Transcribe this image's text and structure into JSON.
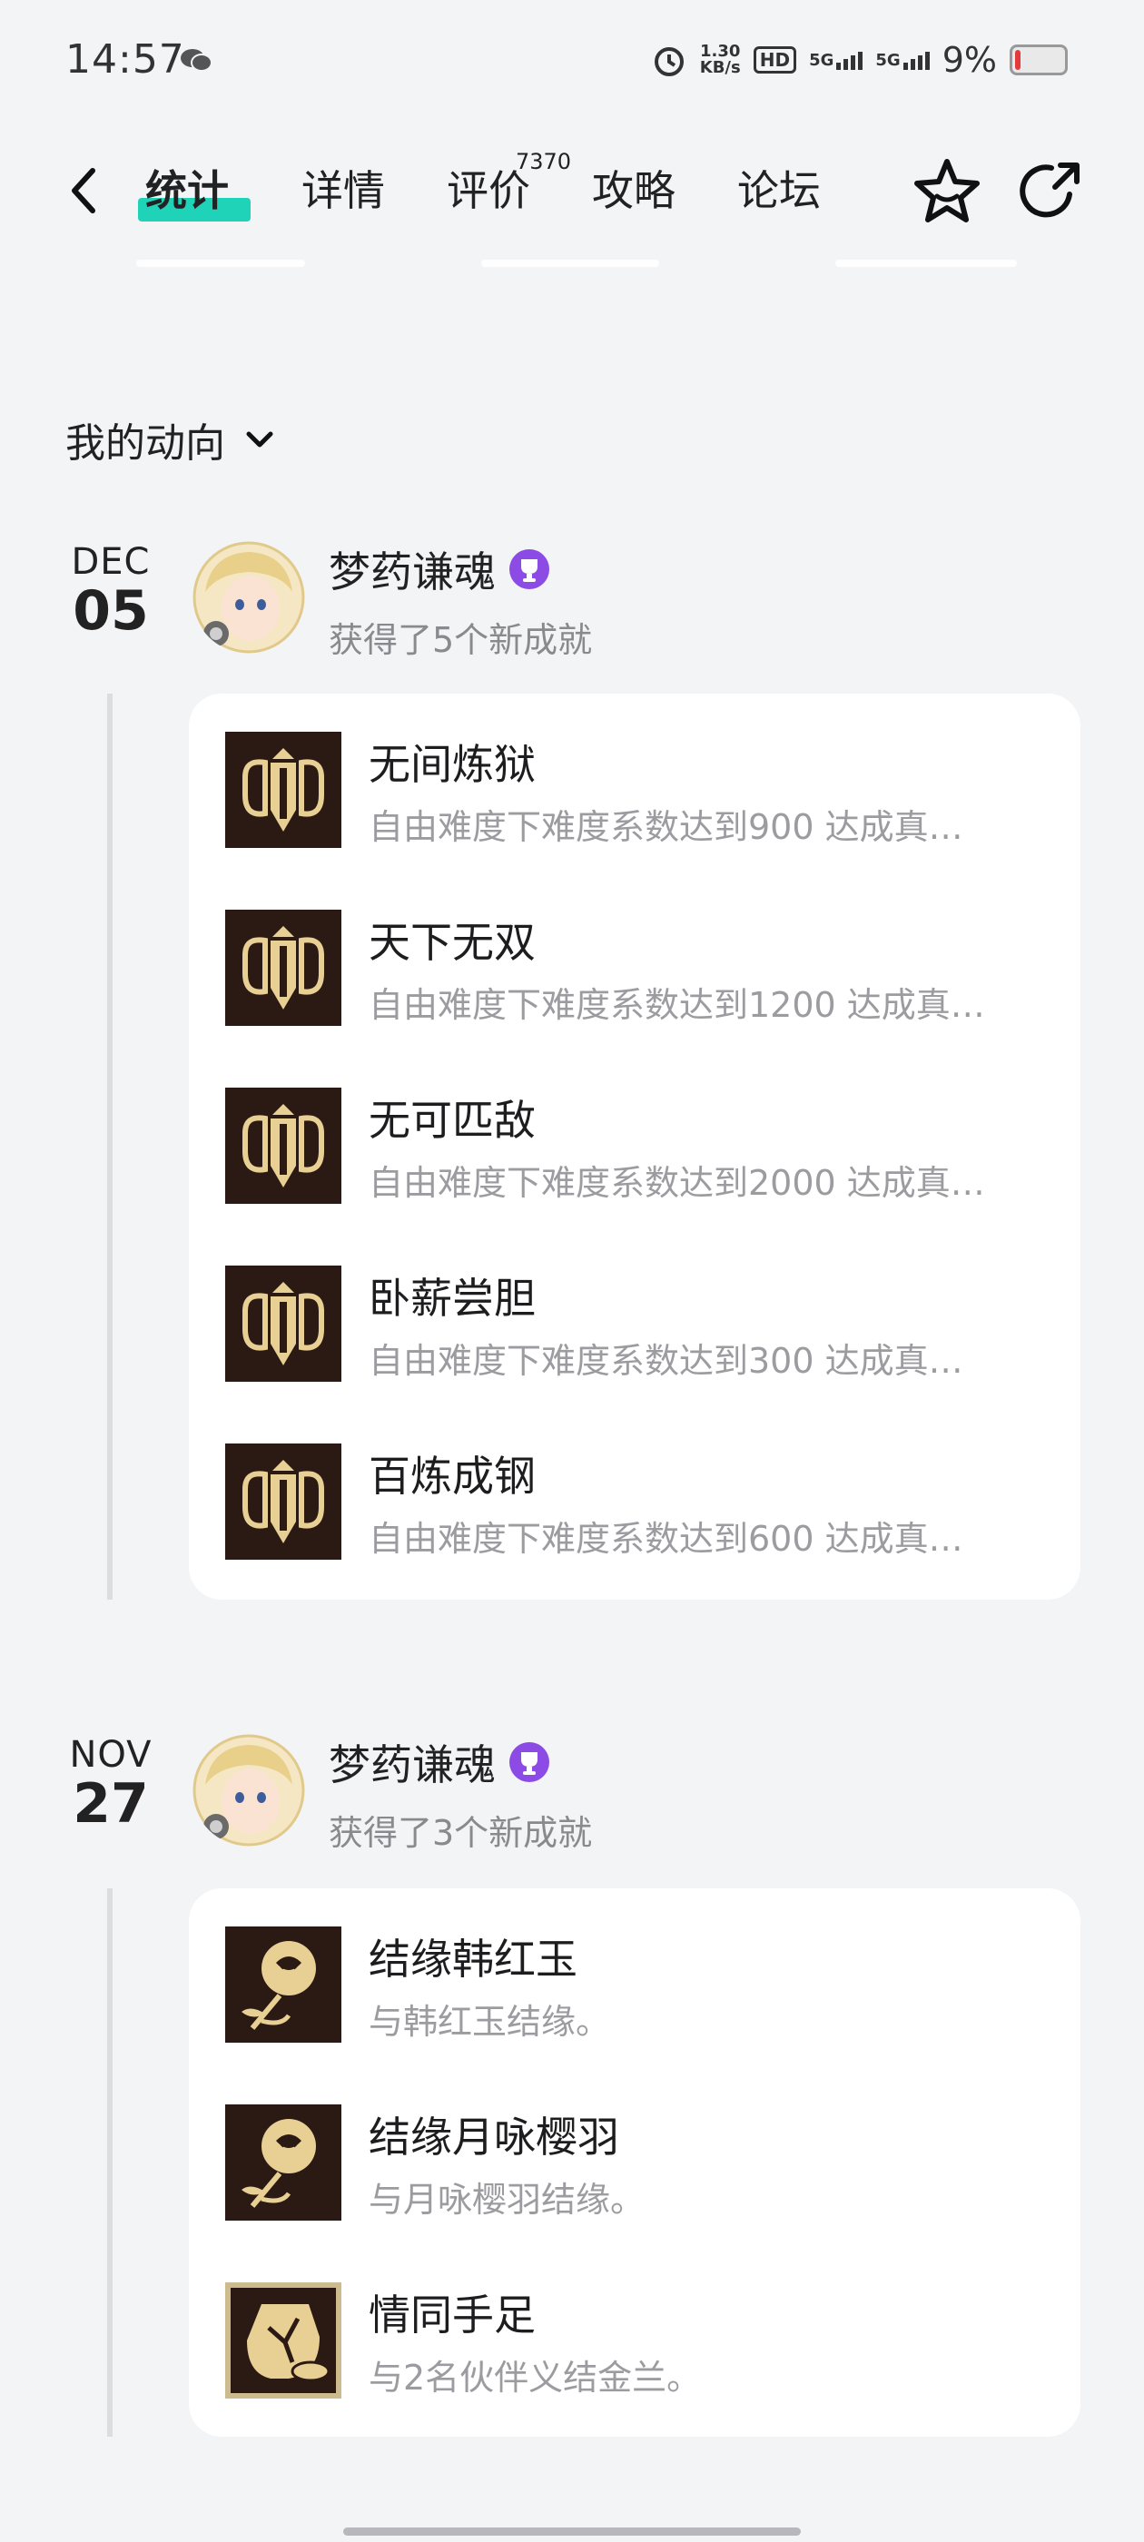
{
  "status_bar": {
    "time": "14:57",
    "net_speed_value": "1.30",
    "net_speed_unit": "KB/s",
    "hd_label": "HD",
    "sig1": "5G",
    "sig2": "5G",
    "battery_pct": "9%",
    "battery_level": 0.09,
    "battery_color": "#e23b3b"
  },
  "nav": {
    "tabs": [
      "统计",
      "详情",
      "评价",
      "攻略",
      "论坛"
    ],
    "review_count": "7370",
    "accent_color": "#1fd3b9",
    "icons": [
      "back-arrow-icon",
      "star-icon",
      "share-icon"
    ]
  },
  "section": {
    "title": "我的动向"
  },
  "groups": [
    {
      "month": "DEC",
      "day": "05",
      "username": "梦药谦魂",
      "summary": "获得了5个新成就",
      "items": [
        {
          "name": "无间炼狱",
          "desc": "自由难度下难度系数达到900 达成真…"
        },
        {
          "name": "天下无双",
          "desc": "自由难度下难度系数达到1200 达成真…"
        },
        {
          "name": "无可匹敌",
          "desc": "自由难度下难度系数达到2000 达成真…"
        },
        {
          "name": "卧薪尝胆",
          "desc": "自由难度下难度系数达到300 达成真…"
        },
        {
          "name": "百炼成钢",
          "desc": "自由难度下难度系数达到600 达成真…"
        }
      ]
    },
    {
      "month": "NOV",
      "day": "27",
      "username": "梦药谦魂",
      "summary": "获得了3个新成就",
      "items": [
        {
          "name": "结缘韩红玉",
          "desc": "与韩红玉结缘。"
        },
        {
          "name": "结缘月咏樱羽",
          "desc": "与月咏樱羽结缘。"
        },
        {
          "name": "情同手足",
          "desc": "与2名伙伴义结金兰。"
        }
      ]
    }
  ]
}
